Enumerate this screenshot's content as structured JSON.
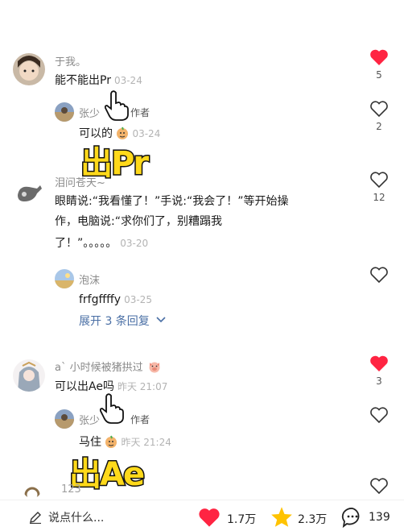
{
  "comments": [
    {
      "author": "于我。",
      "text": "能不能出Pr",
      "time": "03-24",
      "likes": "5",
      "liked": true,
      "reply": {
        "author": "张少",
        "author_tag": "作者",
        "text": "可以的",
        "time": "03-24",
        "likes": "2"
      },
      "sticker": "出Pr"
    },
    {
      "author": "泪问苍天~",
      "text_lines": [
        "眼睛说:“我看懂了！”手说:“我会了！”等开始操",
        "作，电脑说:“求你们了，别糟蹋我",
        "了！”。。。。。"
      ],
      "time": "03-20",
      "likes": "12",
      "liked": false,
      "reply": {
        "author": "泡沫",
        "text": "frfgffffy",
        "time": "03-25"
      },
      "expand_label": "展开 3 条回复"
    },
    {
      "author": "a` 小时候被猪拱过",
      "text": "可以出Ae吗",
      "time": "昨天 21:07",
      "likes": "3",
      "liked": true,
      "reply": {
        "author": "张少",
        "author_tag": "作者",
        "text": "马住",
        "time": "昨天 21:24"
      },
      "sticker": "出Ae"
    },
    {
      "author": "123"
    }
  ],
  "bottom_bar": {
    "input_placeholder": "说点什么...",
    "likes": "1.7万",
    "favorites": "2.3万",
    "comments": "139"
  },
  "colors": {
    "like_red": "#ff2442",
    "star_yellow": "#ffc300",
    "link_blue": "#4a6fa5",
    "sticker_yellow": "#ffd91a"
  }
}
